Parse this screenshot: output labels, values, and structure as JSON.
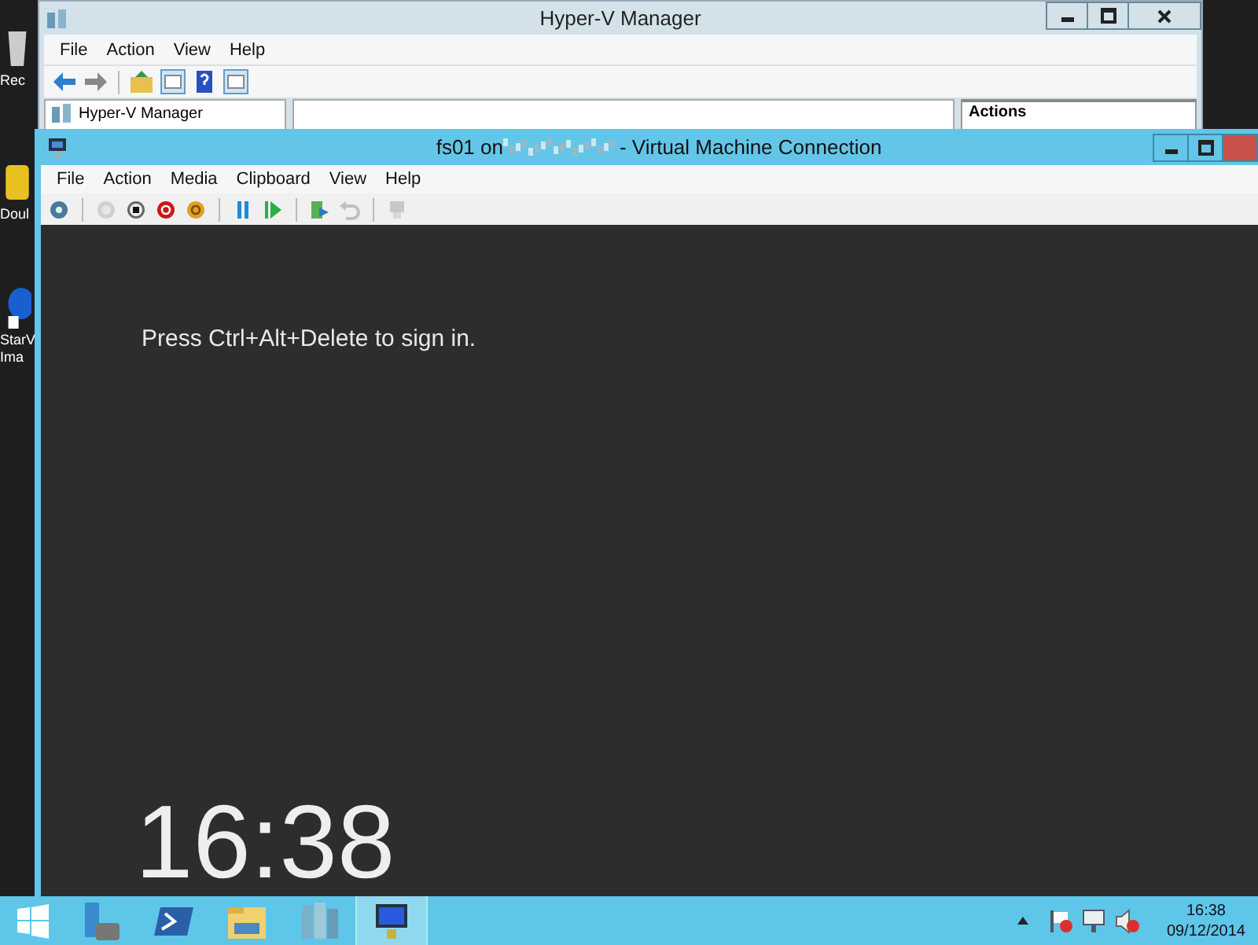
{
  "desktop_icons": [
    {
      "kind": "recycle",
      "lines": [
        "Rec"
      ]
    },
    {
      "kind": "folder",
      "lines": [
        "Doul"
      ]
    },
    {
      "kind": "starwind",
      "lines": [
        "StarV",
        "Ima"
      ]
    }
  ],
  "manager_window": {
    "title": "Hyper-V Manager",
    "menu": [
      "File",
      "Action",
      "View",
      "Help"
    ],
    "toolbar": [
      {
        "kind": "back",
        "separator_before": false
      },
      {
        "kind": "forward",
        "separator_before": false
      },
      {
        "kind": "up-folder",
        "separator_before": true
      },
      {
        "kind": "pane",
        "separator_before": false
      },
      {
        "kind": "help",
        "separator_before": false
      },
      {
        "kind": "pane-right",
        "separator_before": false
      }
    ],
    "tree_item": "Hyper-V Manager",
    "actions_heading": "Actions"
  },
  "vm_window": {
    "title_prefix": "fs01 on",
    "title_suffix": "- Virtual Machine Connection",
    "menu": [
      "File",
      "Action",
      "Media",
      "Clipboard",
      "View",
      "Help"
    ],
    "toolbar": [
      {
        "kind": "ctrl-alt-del",
        "disabled": false,
        "separator_before": false
      },
      {
        "kind": "start",
        "disabled": true,
        "separator_before": true
      },
      {
        "kind": "turn-off",
        "disabled": false,
        "separator_before": false
      },
      {
        "kind": "shutdown",
        "disabled": false,
        "separator_before": false
      },
      {
        "kind": "save",
        "disabled": false,
        "separator_before": false
      },
      {
        "kind": "pause",
        "disabled": false,
        "separator_before": true
      },
      {
        "kind": "resume",
        "disabled": false,
        "separator_before": false
      },
      {
        "kind": "checkpoint",
        "disabled": false,
        "separator_before": true
      },
      {
        "kind": "revert",
        "disabled": true,
        "separator_before": false
      },
      {
        "kind": "enhanced",
        "disabled": true,
        "separator_before": true
      }
    ],
    "lock_message": "Press Ctrl+Alt+Delete to sign in.",
    "clock": "16:38"
  },
  "taskbar": {
    "apps": [
      {
        "kind": "server-manager",
        "selected": false
      },
      {
        "kind": "powershell",
        "selected": false
      },
      {
        "kind": "explorer",
        "selected": false
      },
      {
        "kind": "hyper-v",
        "selected": false
      },
      {
        "kind": "vm-connection",
        "selected": true
      }
    ],
    "tray": [
      {
        "kind": "flag"
      },
      {
        "kind": "network"
      },
      {
        "kind": "speaker"
      }
    ],
    "time": "16:38",
    "date": "09/12/2014"
  }
}
